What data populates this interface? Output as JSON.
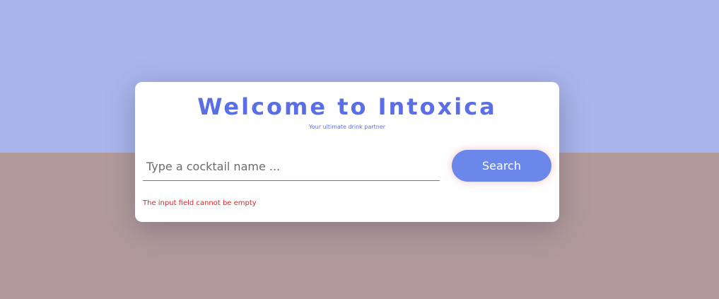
{
  "page": {
    "colors": {
      "background_top": "#a9b5eb",
      "background_bottom": "#b29a9a",
      "accent": "#5a6ee6",
      "button": "#6c87ea",
      "error": "#e02424"
    }
  },
  "card": {
    "title": "Welcome to Intoxica",
    "subtitle": "Your ultimate drink partner",
    "search": {
      "placeholder": "Type a cocktail name ...",
      "value": ""
    },
    "search_button_label": "Search",
    "error_message": "The input field cannot be empty"
  }
}
